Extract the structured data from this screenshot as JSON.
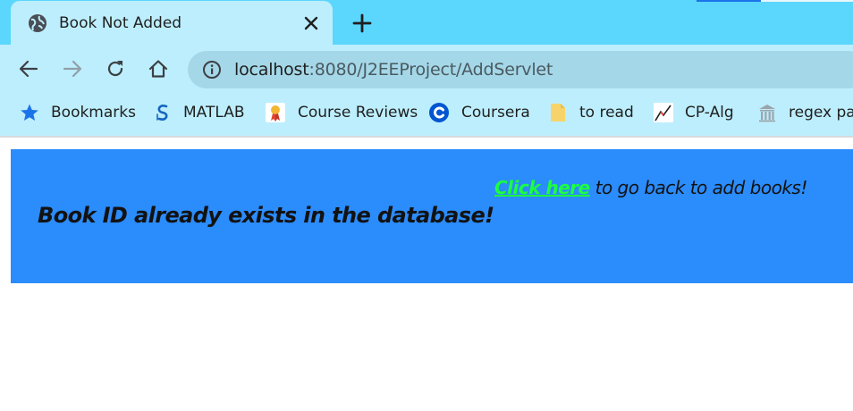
{
  "browser": {
    "tab": {
      "title": "Book Not Added",
      "favicon": "globe-icon"
    },
    "new_tab_symbol": "+",
    "url": {
      "host": "localhost",
      "path": ":8080/J2EEProject/AddServlet"
    },
    "bookmarks": [
      {
        "label": "Bookmarks",
        "icon": "star-icon"
      },
      {
        "label": "MATLAB",
        "icon": "matlab-icon"
      },
      {
        "label": "Course Reviews",
        "icon": "course-reviews-icon"
      },
      {
        "label": "Coursera",
        "icon": "coursera-icon"
      },
      {
        "label": "to read",
        "icon": "folder-icon"
      },
      {
        "label": "CP-Alg",
        "icon": "chart-icon"
      },
      {
        "label": "regex par",
        "icon": "building-icon"
      }
    ],
    "colors": {
      "tab_strip": "#5bd6fc",
      "toolbar": "#bdeefd",
      "omnibox": "#a4d7e8"
    }
  },
  "page": {
    "heading": "Book ID already exists in the database!",
    "back_link": "Click here",
    "back_text": " to go back to add books!",
    "colors": {
      "banner": "#2b8cfb",
      "link": "#1bff3f",
      "text": "#121212"
    }
  }
}
